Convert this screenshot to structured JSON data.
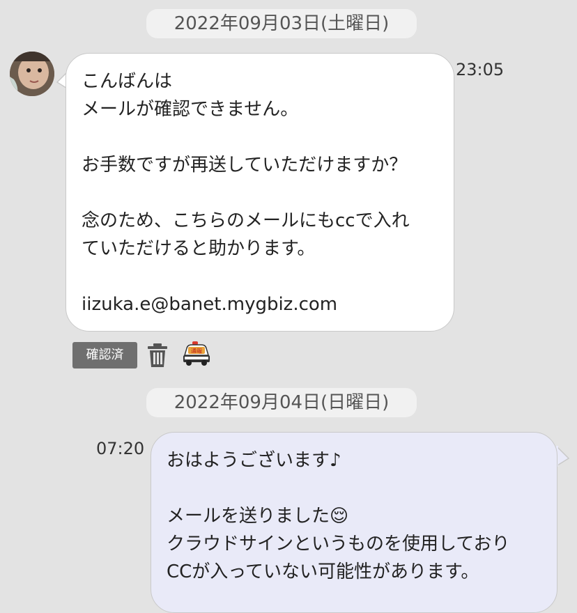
{
  "dates": [
    "2022年09月03日(土曜日)",
    "2022年09月04日(日曜日)"
  ],
  "incoming": {
    "time": "23:05",
    "text": "こんばんは\nメールが確認できません。\n\nお手数ですが再送していただけますか？\n\n念のため、こちらのメールにもccで入れ\nていただけると助かります。\n\niizuka.e@banet.mygbiz.com"
  },
  "actions": {
    "read_label": "確認済",
    "report_label": "通報"
  },
  "outgoing": {
    "time": "07:20",
    "text": "おはようございます♪\n\nメールを送りました😌\nクラウドサインというものを使用しており\nCCが入っていない可能性があります。"
  },
  "colors": {
    "background": "#e3e3e3",
    "incoming_bubble": "#ffffff",
    "outgoing_bubble": "#e9eaf8",
    "date_pill": "#f1f1f1",
    "badge": "#6f6f6f"
  },
  "icons": [
    "trash-icon",
    "police-car-icon"
  ]
}
